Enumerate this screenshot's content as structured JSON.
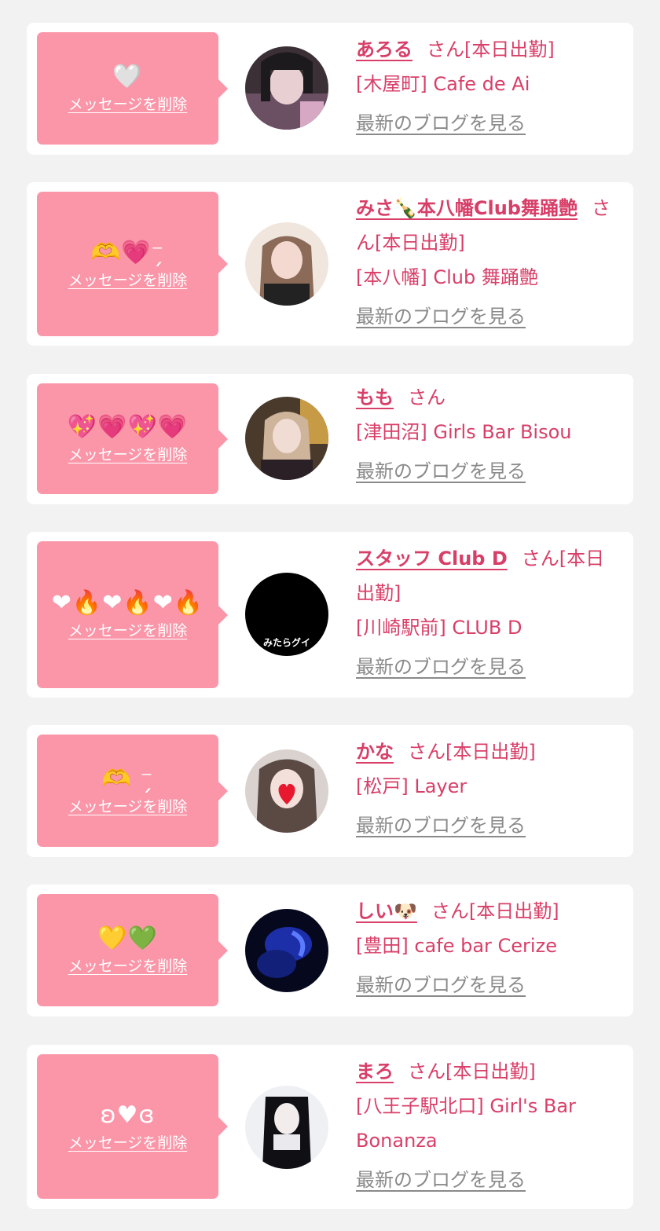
{
  "messages": [
    {
      "emoji": "🤍",
      "delete_label": "メッセージを削除",
      "name": "あろる",
      "suffix": "さん[本日出勤]",
      "shop": "[木屋町] Cafe de Ai",
      "blog_label": "最新のブログを見る"
    },
    {
      "emoji": "🫶💗⁻̗",
      "delete_label": "メッセージを削除",
      "name": "みさ🍾本八幡Club舞踊艶",
      "suffix": "さん[本日出勤]",
      "shop": "[本八幡] Club 舞踊艶",
      "blog_label": "最新のブログを見る"
    },
    {
      "emoji": "💖💗💖💗",
      "delete_label": "メッセージを削除",
      "name": "もも",
      "suffix": "さん",
      "shop": "[津田沼] Girls Bar Bisou",
      "blog_label": "最新のブログを見る"
    },
    {
      "emoji": "❤︎🔥❤︎🔥❤︎🔥",
      "delete_label": "メッセージを削除",
      "name": "スタッフ Club D",
      "suffix": "さん[本日出勤]",
      "shop": "[川崎駅前] CLUB D",
      "blog_label": "最新のブログを見る",
      "avatar_text": "みたらグイ"
    },
    {
      "emoji": "🫶 ⁻̗",
      "delete_label": "メッセージを削除",
      "name": "かな",
      "suffix": "さん[本日出勤]",
      "shop": "[松戸] Layer",
      "blog_label": "最新のブログを見る"
    },
    {
      "emoji": "💛💚",
      "delete_label": "メッセージを削除",
      "name": "しい🐶",
      "suffix": "さん[本日出勤]",
      "shop": "[豊田] cafe bar Cerize",
      "blog_label": "最新のブログを見る"
    },
    {
      "emoji": "ʚ♥ɞ",
      "delete_label": "メッセージを削除",
      "name": "まろ",
      "suffix": "さん[本日出勤]",
      "shop": "[八王子駅北口] Girl's Bar Bonanza",
      "blog_label": "最新のブログを見る"
    }
  ],
  "colors": {
    "page_bg": "#f2f2f2",
    "card_bg": "#ffffff",
    "bubble_bg": "#fb96a9",
    "accent": "#d83f68",
    "link_gray": "#8a8a8a"
  }
}
